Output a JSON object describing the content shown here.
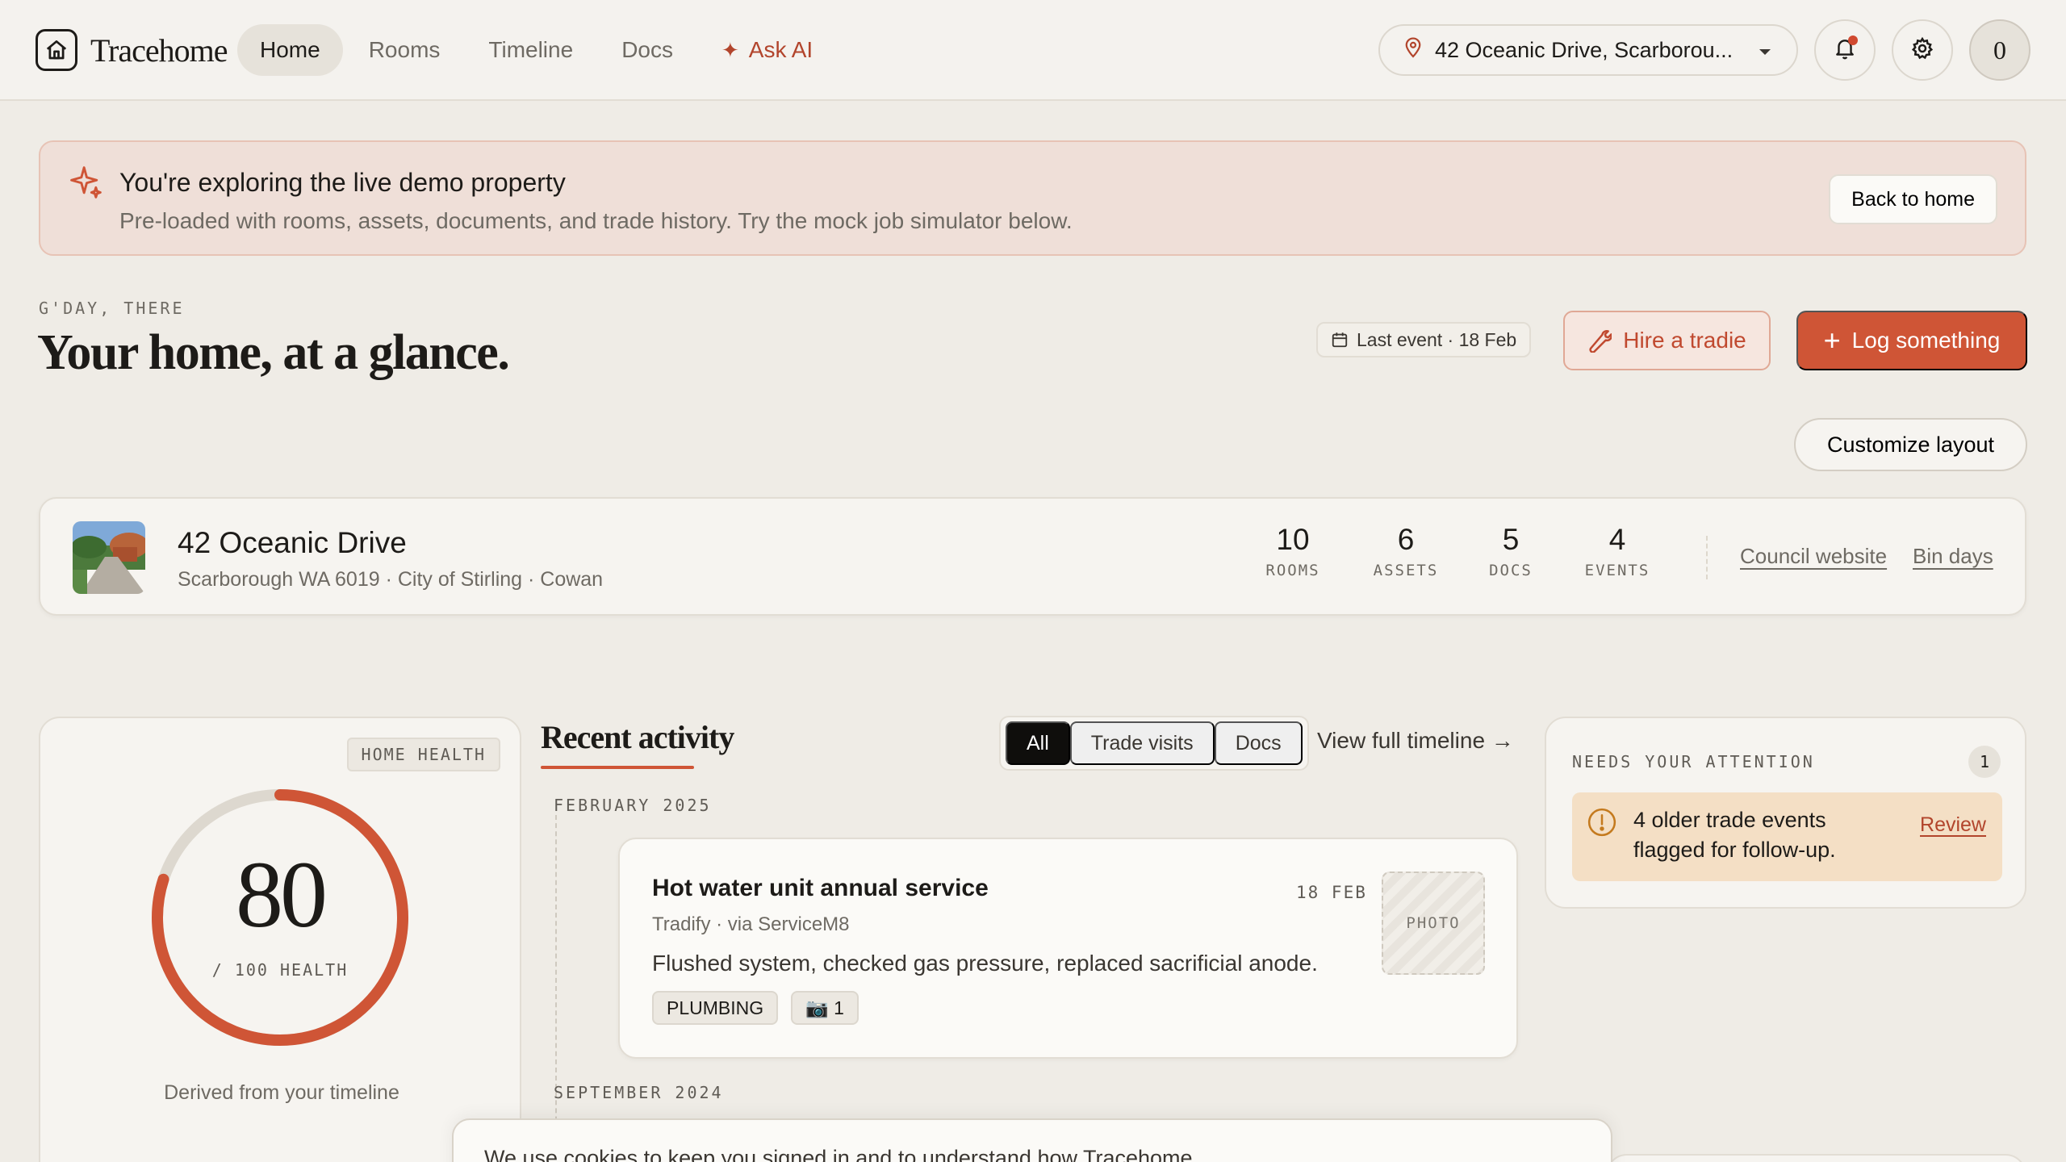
{
  "app": {
    "name": "Tracehome"
  },
  "nav": {
    "links": [
      {
        "label": "Home",
        "active": true
      },
      {
        "label": "Rooms",
        "active": false
      },
      {
        "label": "Timeline",
        "active": false
      },
      {
        "label": "Docs",
        "active": false
      }
    ],
    "ask_ai": "Ask AI",
    "address_select": "42 Oceanic Drive, Scarborou...",
    "avatar_initial": "0"
  },
  "banner": {
    "title": "You're exploring the live demo property",
    "subtitle": "Pre-loaded with rooms, assets, documents, and trade history. Try the mock job simulator below.",
    "button": "Back to home"
  },
  "greeting": {
    "eyebrow": "G'DAY, THERE",
    "title": "Your home, at a glance.",
    "last_event": "Last event · 18 Feb",
    "hire_button": "Hire a tradie",
    "log_button": "Log something",
    "customize_button": "Customize layout"
  },
  "property": {
    "name": "42 Oceanic Drive",
    "subtitle": "Scarborough WA 6019 · City of Stirling · Cowan",
    "stats": [
      {
        "value": "10",
        "label": "ROOMS"
      },
      {
        "value": "6",
        "label": "ASSETS"
      },
      {
        "value": "5",
        "label": "DOCS"
      },
      {
        "value": "4",
        "label": "EVENTS"
      }
    ],
    "links": [
      "Council website",
      "Bin days"
    ]
  },
  "health": {
    "badge": "HOME HEALTH",
    "score": "80",
    "score_fraction": 0.8,
    "label": "/ 100 HEALTH",
    "footer": "Derived from your timeline",
    "colors": {
      "fill": "#cf5536",
      "track": "#ddd8cf"
    }
  },
  "activity": {
    "title": "Recent activity",
    "filters": [
      {
        "label": "All",
        "active": true
      },
      {
        "label": "Trade visits",
        "active": false
      },
      {
        "label": "Docs",
        "active": false
      }
    ],
    "view_full": "View full timeline →",
    "months": [
      "FEBRUARY 2025",
      "SEPTEMBER 2024"
    ],
    "events": [
      {
        "title": "Hot water unit annual service",
        "date": "18 FEB",
        "source": "Tradify · via ServiceM8",
        "description": "Flushed system, checked gas pressure, replaced sacrificial anode.",
        "photo_label": "PHOTO",
        "tags": [
          "PLUMBING",
          "📷 1"
        ]
      }
    ]
  },
  "attention": {
    "heading": "NEEDS YOUR ATTENTION",
    "count": "1",
    "items": [
      {
        "text": "4 older trade events flagged for follow-up.",
        "action": "Review"
      }
    ]
  },
  "cookie": {
    "text": "We use cookies to keep you signed in and to understand how Tracehome"
  },
  "colors": {
    "accent": "#cf5536",
    "background": "#efece6",
    "surface": "#f6f4f0"
  }
}
